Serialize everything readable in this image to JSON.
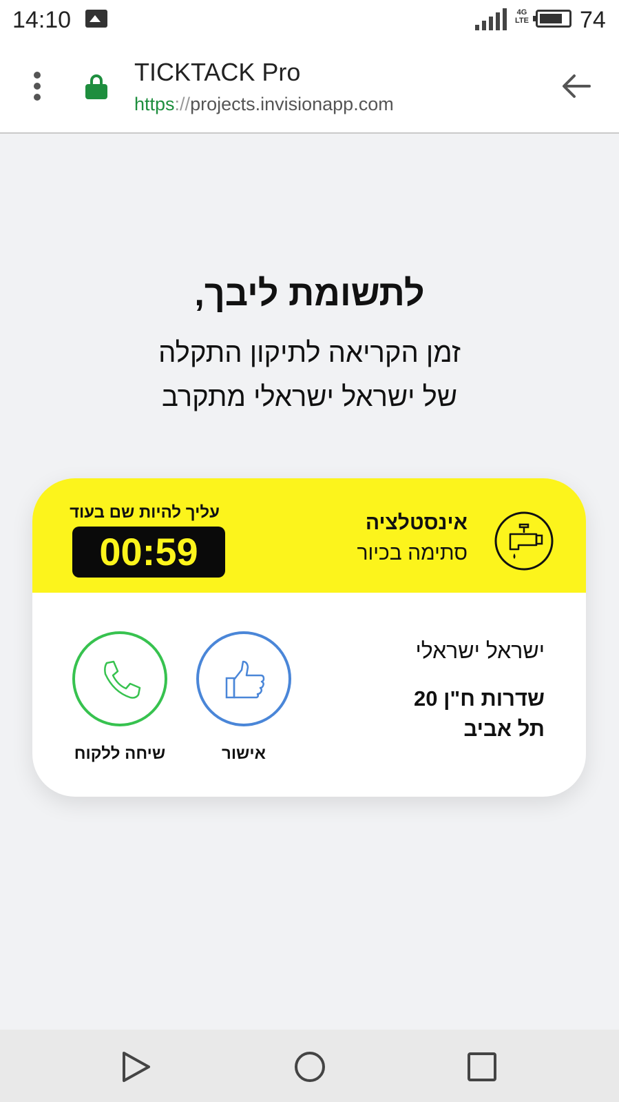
{
  "status_bar": {
    "time": "14:10",
    "network": "4G LTE",
    "battery": "74"
  },
  "browser": {
    "title": "TICKTACK Pro",
    "url_scheme": "https",
    "url_separator": "://",
    "url_host": "projects.invisionapp.com"
  },
  "headline": {
    "title": "לתשומת ליבך,",
    "line1": "זמן הקריאה לתיקון התקלה",
    "line2": "של ישראל ישראלי מתקרב"
  },
  "card": {
    "service_title": "אינסטלציה",
    "service_subtitle": "סתימה בכיור",
    "timer_label": "עליך להיות שם בעוד",
    "timer_value": "00:59",
    "customer_name": "ישראל ישראלי",
    "address_line1": "שדרות ח\"ן 20",
    "address_line2": "תל אביב",
    "approve_label": "אישור",
    "call_label": "שיחה ללקוח"
  },
  "colors": {
    "accent_yellow": "#fcf41c",
    "approve_blue": "#4a86d8",
    "call_green": "#37c24f",
    "secure_green": "#1e8e3e"
  },
  "icons": {
    "service": "water-tap-icon",
    "approve": "thumbs-up-icon",
    "call": "phone-icon"
  }
}
